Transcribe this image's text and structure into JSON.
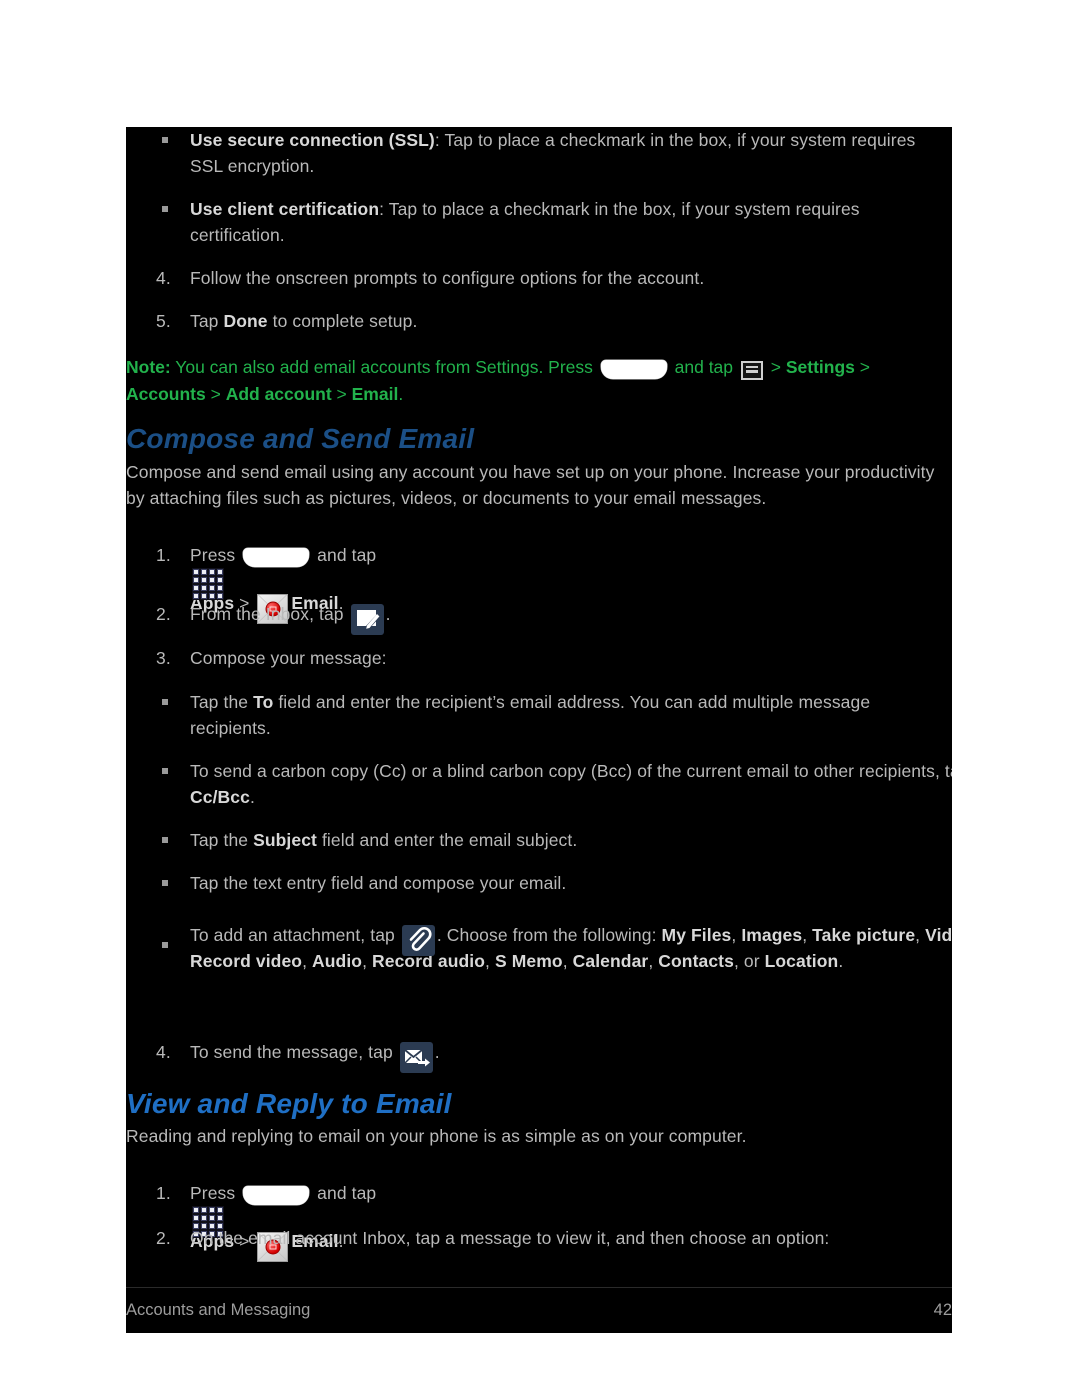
{
  "page": {
    "background_color": "#000000",
    "text_color": "#b9b9b9",
    "bold_text_color": "#d8d8d8",
    "note_color": "#22b24c",
    "heading_color_dark": "#1b4f86",
    "heading_color_bright": "#1f6fc4"
  },
  "bullets_ssl": {
    "item1_bold": "Use secure connection (SSL)",
    "item1_rest": ": Tap to place a checkmark in the box, if your system requires SSL encryption.",
    "item2_bold": "Use client certification",
    "item2_rest": ": Tap to place a checkmark in the box, if your system requires certification."
  },
  "steps_setup": {
    "step4_num": "4.",
    "step4_text": "Follow the onscreen prompts to configure options for the account.",
    "step5_num": "5.",
    "step5_pre": "Tap ",
    "step5_bold": "Done",
    "step5_post": " to complete setup."
  },
  "note": {
    "label": "Note:",
    "text_1": " You can also add email accounts from Settings. Press ",
    "text_2": " and tap ",
    "text_3": " > ",
    "bold_settings": "Settings",
    "sep_1": " > ",
    "bold_accounts": "Accounts",
    "sep_2": " > ",
    "bold_add_account": "Add account",
    "sep_3": " > ",
    "bold_email": "Email",
    "period": ".",
    "home_icon": "home-key-icon",
    "menu_icon": "menu-key-icon"
  },
  "section_compose": {
    "heading": "Compose and Send Email",
    "intro": "Compose and send email using any account you have set up on your phone. Increase your productivity by attaching files such as pictures, videos, or documents to your email messages.",
    "step1": {
      "num": "1.",
      "pre": "Press ",
      "mid": " and tap ",
      "apps_label": "Apps",
      "arrow": " > ",
      "email_label": "Email",
      "period": ".",
      "home_icon": "home-key-icon",
      "apps_icon": "apps-grid-icon",
      "email_icon": "email-app-icon"
    },
    "step2": {
      "num": "2.",
      "pre": "From the Inbox, tap ",
      "post": ".",
      "compose_icon": "compose-icon"
    },
    "step3": {
      "num": "3.",
      "text": "Compose your message:"
    },
    "sub_bullets": {
      "b1_pre": "Tap the ",
      "b1_bold": "To",
      "b1_post": " field and enter the recipient’s email address. You can add multiple message recipients.",
      "b2_pre": "To send a carbon copy (Cc) or a blind carbon copy (Bcc) of the current email to other recipients, tap ",
      "b2_bold": "Cc/Bcc",
      "b2_post": ".",
      "b3_pre": "Tap the ",
      "b3_bold": "Subject",
      "b3_post": " field and enter the email subject.",
      "b4_text": "Tap the text entry field and compose your email.",
      "b5_pre": "To add an attachment, tap ",
      "b5_mid": ". Choose from the following: ",
      "b5_icon": "attachment-paperclip-icon",
      "b5_options": [
        "My Files",
        "Images",
        "Take picture",
        "Video",
        "Record video",
        "Audio",
        "Record audio",
        "S Memo",
        "Calendar",
        "Contacts"
      ],
      "b5_or": ", or ",
      "b5_last": "Location",
      "b5_period": "."
    },
    "step4": {
      "num": "4.",
      "pre": "To send the message, tap ",
      "post": ".",
      "send_icon": "send-email-icon"
    }
  },
  "section_view": {
    "heading": "View and Reply to Email",
    "intro": "Reading and replying to email on your phone is as simple as on your computer.",
    "step1": {
      "num": "1.",
      "pre": "Press ",
      "mid": " and tap ",
      "apps_label": "Apps",
      "arrow": " > ",
      "email_label": "Email",
      "period": ".",
      "home_icon": "home-key-icon",
      "apps_icon": "apps-grid-icon",
      "email_icon": "email-app-icon"
    },
    "step2": {
      "num": "2.",
      "text": "On the email account Inbox, tap a message to view it, and then choose an option:"
    }
  },
  "footer": {
    "left": "Accounts and Messaging",
    "right": "42"
  }
}
